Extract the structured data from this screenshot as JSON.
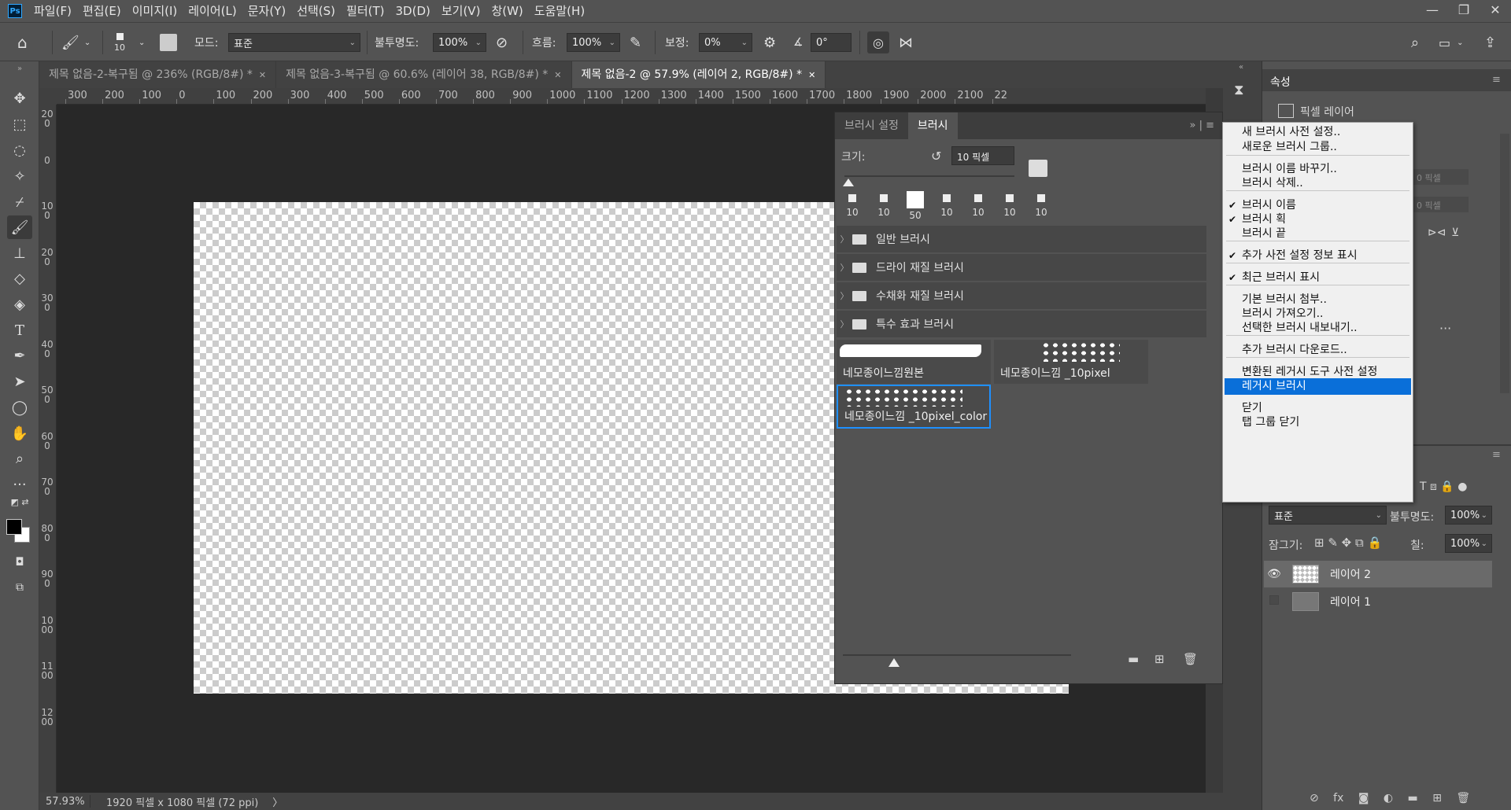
{
  "app": {
    "logo": "Ps"
  },
  "menubar": [
    "파일(F)",
    "편집(E)",
    "이미지(I)",
    "레이어(L)",
    "문자(Y)",
    "선택(S)",
    "필터(T)",
    "3D(D)",
    "보기(V)",
    "창(W)",
    "도움말(H)"
  ],
  "window_controls": [
    "—",
    "❐",
    "✕"
  ],
  "options": {
    "brush_size": "10",
    "mode_label": "모드:",
    "mode_value": "표준",
    "opacity_label": "불투명도:",
    "opacity_value": "100%",
    "flow_label": "흐름:",
    "flow_value": "100%",
    "smoothing_label": "보정:",
    "smoothing_value": "0%",
    "angle_value": "0°"
  },
  "doc_tabs": [
    {
      "label": "제목 없음-2-복구됨 @ 236% (RGB/8#) *",
      "active": false
    },
    {
      "label": "제목 없음-3-복구됨 @ 60.6% (레이어 38, RGB/8#) *",
      "active": false
    },
    {
      "label": "제목 없음-2 @ 57.9% (레이어 2, RGB/8#) *",
      "active": true
    }
  ],
  "ruler_h": [
    "300",
    "200",
    "100",
    "0",
    "100",
    "200",
    "300",
    "400",
    "500",
    "600",
    "700",
    "800",
    "900",
    "1000",
    "1100",
    "1200",
    "1300",
    "1400",
    "1500",
    "1600",
    "1700",
    "1800",
    "1900",
    "2000",
    "2100",
    "22"
  ],
  "ruler_v": [
    "200",
    "0",
    "100",
    "200",
    "300",
    "400",
    "500",
    "600",
    "700",
    "800",
    "900",
    "1000",
    "1100",
    "1200"
  ],
  "status": {
    "zoom": "57.93%",
    "doc_size": "1920 픽셀 x 1080 픽셀 (72 ppi)",
    "arrow": "〉"
  },
  "brush_panel": {
    "tabs": [
      "브러시 설정",
      "브러시"
    ],
    "size_label": "크기:",
    "size_value": "10 픽셀",
    "recent_tips": [
      "10",
      "10",
      "50",
      "10",
      "10",
      "10",
      "10"
    ],
    "folders": [
      "일반 브러시",
      "드라이 재질 브러시",
      "수채화 재질 브러시",
      "특수 효과 브러시"
    ],
    "presets": [
      "네모종이느낌원본",
      "네모종이느낌 _10pixel",
      "네모종이느낌 _10pixel_color"
    ]
  },
  "context_menu": {
    "items": [
      {
        "label": "새 브러시 사전 설정..",
        "checked": false
      },
      {
        "label": "새로운 브러시 그룹..",
        "checked": false
      },
      {
        "label": "브러시 이름 바꾸기..",
        "checked": false
      },
      {
        "label": "브러시 삭제..",
        "checked": false
      },
      {
        "label": "브러시 이름",
        "checked": true
      },
      {
        "label": "브러시 획",
        "checked": true
      },
      {
        "label": "브러시 끝",
        "checked": false
      },
      {
        "label": "추가 사전 설정 정보 표시",
        "checked": true
      },
      {
        "label": "최근 브러시 표시",
        "checked": true
      },
      {
        "label": "기본 브러시 첨부..",
        "checked": false
      },
      {
        "label": "브러시 가져오기..",
        "checked": false
      },
      {
        "label": "선택한 브러시 내보내기..",
        "checked": false
      },
      {
        "label": "추가 브러시 다운로드..",
        "checked": false
      },
      {
        "label": "변환된 레거시 도구 사전 설정",
        "checked": false
      },
      {
        "label": "레거시 브러시",
        "checked": false,
        "highlighted": true
      },
      {
        "label": "닫기",
        "checked": false
      },
      {
        "label": "탭 그룹 닫기",
        "checked": false
      }
    ]
  },
  "properties": {
    "tab": "속성",
    "kind": "픽셀 레이어",
    "w_placeholder": "0 픽셀",
    "h_placeholder": "0 픽셀"
  },
  "layers": {
    "blend_mode": "표준",
    "opacity_label": "불투명도:",
    "opacity_value": "100%",
    "lock_label": "잠그기:",
    "fill_label": "칠:",
    "fill_value": "100%",
    "items": [
      {
        "name": "레이어 2",
        "visible": true,
        "selected": true
      },
      {
        "name": "레이어 1",
        "visible": false,
        "selected": false
      }
    ]
  },
  "colors": {
    "accent": "#0a6fd9",
    "panel": "#535353",
    "dark": "#282828",
    "selection_border": "#1e90ff"
  }
}
